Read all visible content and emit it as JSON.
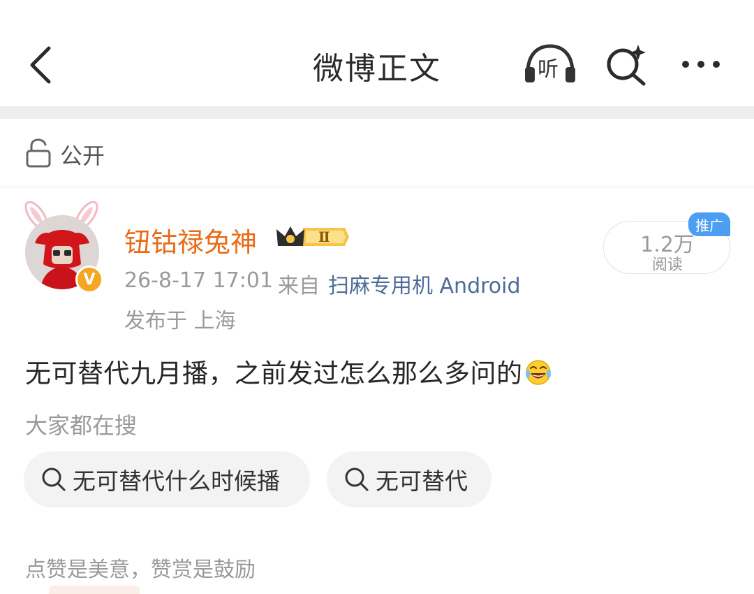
{
  "nav": {
    "title": "微博正文",
    "listen_label": "听"
  },
  "visibility": {
    "label": "公开"
  },
  "author": {
    "name": "钮钴禄兔神",
    "vip_level": "Ⅱ",
    "verified_mark": "V",
    "time": "26-8-17 17:01",
    "from_prefix": "来自",
    "device": "扫麻专用机 Android",
    "location": "发布于 上海"
  },
  "stats": {
    "read_count": "1.2万",
    "read_label": "阅读",
    "promo_tag": "推广"
  },
  "post": {
    "text": "无可替代九月播，之前发过怎么那么多问的"
  },
  "hot_search": {
    "title": "大家都在搜",
    "items": [
      {
        "label": "无可替代什么时候播"
      },
      {
        "label": "无可替代"
      }
    ]
  },
  "reward": {
    "text": "点赞是美意，赞赏是鼓励"
  },
  "colors": {
    "name_orange": "#e86b17",
    "link_blue": "#4d6b96",
    "promo_blue": "#4c9ef0",
    "meta_gray": "#9a9a9a"
  },
  "icons": [
    "back-arrow-icon",
    "listen-headphones-icon",
    "search-sparkle-icon",
    "more-dots-icon",
    "lock-icon",
    "crown-icon",
    "laughing-emoji-icon",
    "search-icon"
  ]
}
